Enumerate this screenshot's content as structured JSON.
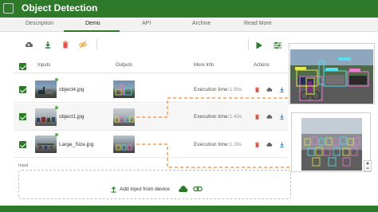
{
  "app": {
    "title": "Object Detection"
  },
  "tabs": [
    "Description",
    "Demo",
    "API",
    "Archive",
    "Read More"
  ],
  "active_tab": "Demo",
  "table": {
    "headers": {
      "inputs": "Inputs",
      "outputs": "Outputs",
      "more_info": "More Info",
      "actions": "Actions"
    },
    "exec_label": "Execution time:",
    "rows": [
      {
        "file": "object4.jpg",
        "exec_time": "1.98s"
      },
      {
        "file": "object1.jpg",
        "exec_time": "1.40s"
      },
      {
        "file": "Large_Size.jpg",
        "exec_time": "1.39s"
      }
    ]
  },
  "input_section": {
    "label": "Input",
    "add_label": "Add input from device"
  },
  "colors": {
    "brand": "#2e7a2a",
    "delete": "#e05545",
    "download": "#2d8fd6",
    "connector": "#f08a3a"
  },
  "icons": [
    "cloud-upload-icon",
    "download-icon",
    "trash-icon",
    "no-eye-icon",
    "play-icon",
    "settings-icon",
    "cloud-icon",
    "link-icon",
    "upload-arrow-icon"
  ]
}
